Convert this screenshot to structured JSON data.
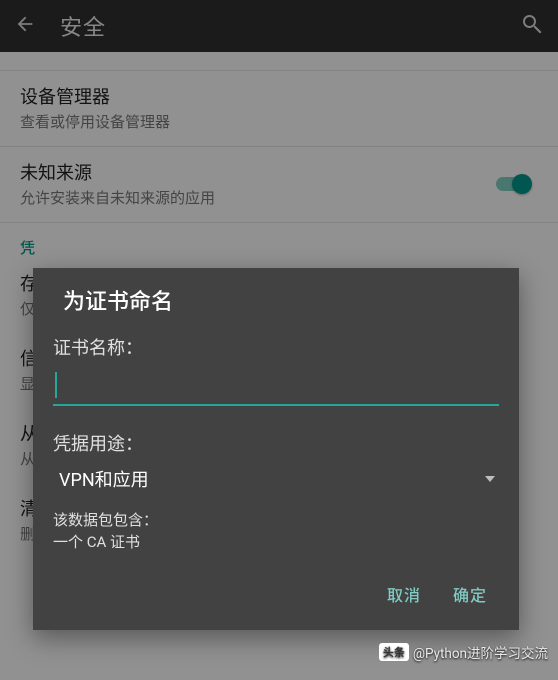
{
  "appbar": {
    "title": "安全"
  },
  "list": {
    "deviceAdmin": {
      "title": "设备管理器",
      "sub": "查看或停用设备管理器"
    },
    "unknownSources": {
      "title": "未知来源",
      "sub": "允许安装来自未知来源的应用"
    },
    "categoryCredentials": "凭",
    "storage": {
      "ti": "存",
      "sub": "仅"
    },
    "trusted": {
      "ti": "信",
      "sub": "显"
    },
    "install": {
      "ti": "从",
      "sub": "从"
    },
    "clear": {
      "ti": "清",
      "sub": "删"
    }
  },
  "dialog": {
    "title": "为证书命名",
    "nameLabel": "证书名称：",
    "usageLabel": "凭据用途：",
    "usageValue": "VPN和应用",
    "packageContains": "该数据包包含：",
    "packageItem": "一个 CA 证书",
    "cancel": "取消",
    "ok": "确定"
  },
  "watermark": {
    "logo": "头条",
    "handle": "@Python进阶学习交流"
  }
}
